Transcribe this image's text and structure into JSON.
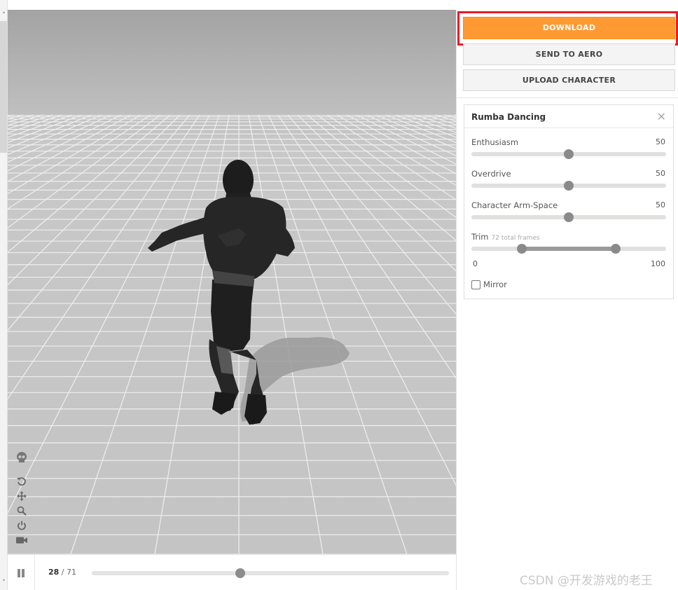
{
  "actions": {
    "download_label": "DOWNLOAD",
    "send_to_aero_label": "SEND TO AERO",
    "upload_character_label": "UPLOAD CHARACTER"
  },
  "animation_panel": {
    "title": "Rumba Dancing",
    "close_glyph": "✕",
    "params": [
      {
        "label": "Enthusiasm",
        "value": "50",
        "fraction": 0.5
      },
      {
        "label": "Overdrive",
        "value": "50",
        "fraction": 0.5
      },
      {
        "label": "Character Arm-Space",
        "value": "50",
        "fraction": 0.5
      }
    ],
    "trim": {
      "label": "Trim",
      "sub_label": "72 total frames",
      "min_label": "0",
      "max_label": "100",
      "start_fraction": 0.26,
      "end_fraction": 0.74
    },
    "mirror": {
      "label": "Mirror",
      "checked": false
    }
  },
  "viewport_tools": [
    {
      "icon": "skeleton-icon"
    },
    {
      "icon": "reset-view-icon"
    },
    {
      "icon": "pan-icon"
    },
    {
      "icon": "zoom-icon"
    },
    {
      "icon": "power-icon"
    },
    {
      "icon": "camera-icon"
    }
  ],
  "playback": {
    "current_frame": "28",
    "total_frames": "71",
    "separator": " / ",
    "progress_fraction": 0.415,
    "state": "playing"
  },
  "watermark": "CSDN @开发游戏的老王",
  "colors": {
    "download_bg": "#ff9a33",
    "highlight_border": "#e81c24",
    "slider_knob": "#8a8a8a"
  }
}
